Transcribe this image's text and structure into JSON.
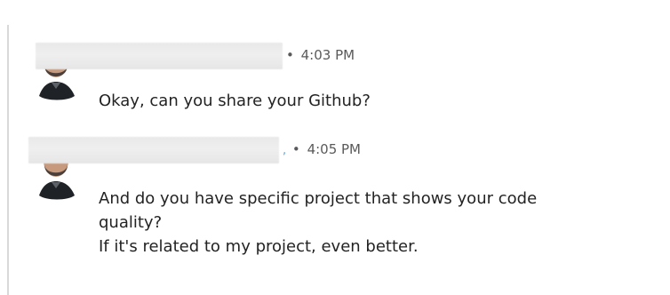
{
  "messages": [
    {
      "time": "4:03 PM",
      "separator": "•",
      "lines": [
        "Okay, can you share your Github?"
      ]
    },
    {
      "time": "4:05 PM",
      "separator": "•",
      "tick": ",",
      "lines": [
        "And do you have specific project that shows your code",
        "quality?",
        "If it's related to my project, even better."
      ]
    }
  ],
  "colors": {
    "rule": "#d9d9d9",
    "meta_text": "#5a5a5a",
    "body_text": "#232323",
    "redaction": "#ebebeb",
    "tick": "#58a6e8"
  },
  "icons": {
    "avatar": "user-avatar-icon"
  }
}
